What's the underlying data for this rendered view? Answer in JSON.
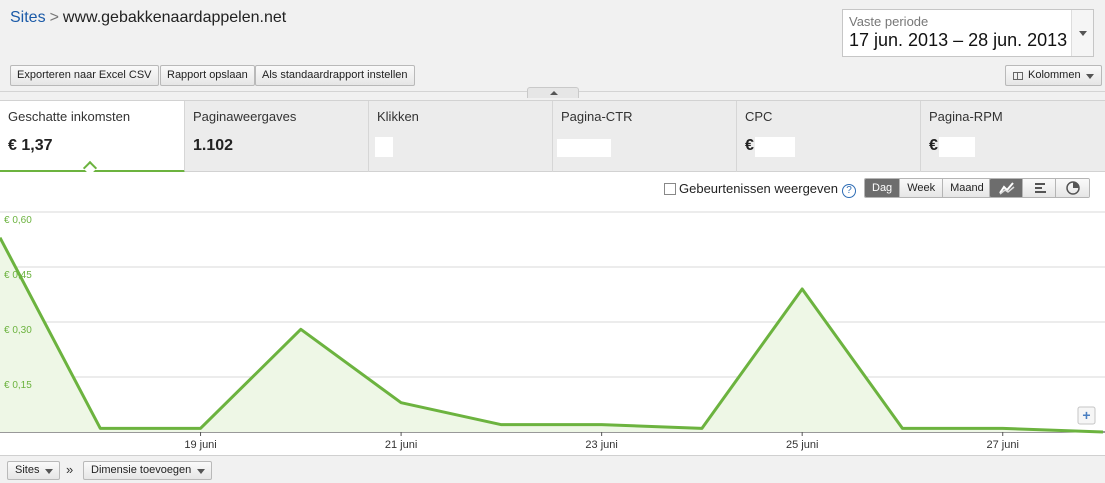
{
  "breadcrumb": {
    "root": "Sites",
    "separator": ">",
    "current": "www.gebakkenaardappelen.net"
  },
  "date_range": {
    "label": "Vaste periode",
    "value": "17 jun. 2013 – 28 jun. 2013"
  },
  "toolbar": {
    "export_label": "Exporteren naar Excel CSV",
    "save_label": "Rapport opslaan",
    "default_label": "Als standaardrapport instellen",
    "columns_label": "Kolommen"
  },
  "metrics": [
    {
      "label": "Geschatte inkomsten",
      "value": "€ 1,37",
      "active": true
    },
    {
      "label": "Paginaweergaves",
      "value": "1.102"
    },
    {
      "label": "Klikken",
      "value": ""
    },
    {
      "label": "Pagina-CTR",
      "value": ""
    },
    {
      "label": "CPC",
      "value": "€"
    },
    {
      "label": "Pagina-RPM",
      "value": "€"
    }
  ],
  "chart_controls": {
    "events_label": "Gebeurtenissen weergeven",
    "help": "?",
    "granularity": [
      "Dag",
      "Week",
      "Maand"
    ],
    "granularity_selected": "Dag",
    "view_icons": [
      "line-chart-icon",
      "bar-chart-icon",
      "pie-chart-icon"
    ],
    "view_selected": "line-chart-icon"
  },
  "chart_data": {
    "type": "area",
    "x": [
      "17 jun",
      "18 jun",
      "19 jun",
      "20 jun",
      "21 jun",
      "22 jun",
      "23 jun",
      "24 jun",
      "25 jun",
      "26 jun",
      "27 jun",
      "28 jun"
    ],
    "y": [
      0.53,
      0.01,
      0.01,
      0.28,
      0.08,
      0.02,
      0.02,
      0.01,
      0.39,
      0.01,
      0.01,
      0.0
    ],
    "x_tick_labels": [
      "19 juni",
      "21 juni",
      "23 juni",
      "25 juni",
      "27 juni"
    ],
    "y_tick_labels": [
      "€ 0,60",
      "€ 0,45",
      "€ 0,30",
      "€ 0,15"
    ],
    "ylim": [
      0,
      0.6
    ],
    "line_color": "#6cb33f",
    "fill_color": "#eef7e6",
    "grid": true
  },
  "bottom_bar": {
    "sites_label": "Sites",
    "separator": "»",
    "dimension_label": "Dimensie toevoegen"
  }
}
